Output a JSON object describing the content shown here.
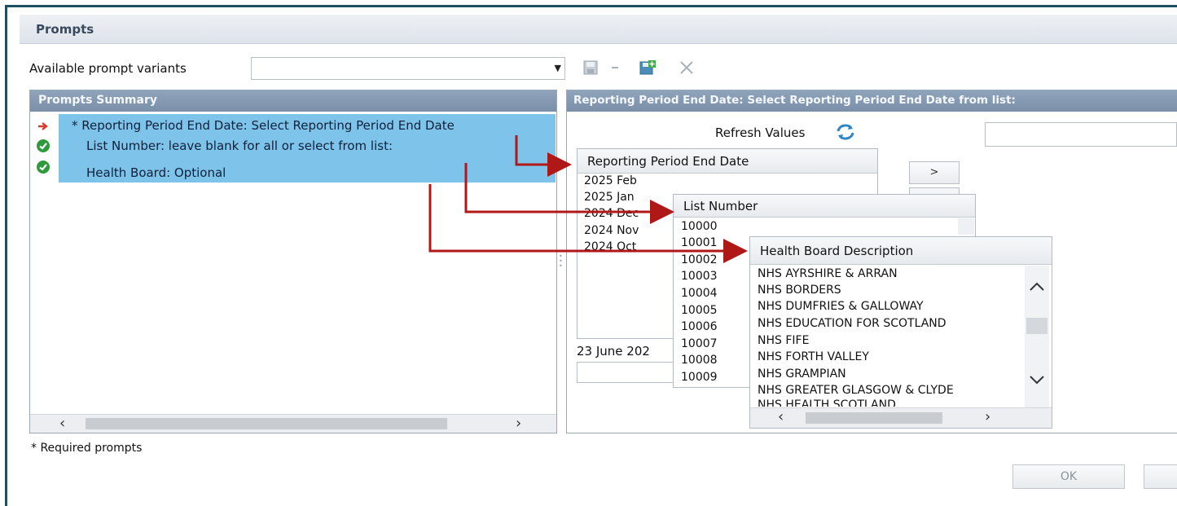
{
  "dialog": {
    "title": "Prompts"
  },
  "variants": {
    "label": "Available prompt variants",
    "value": ""
  },
  "toolbar": {
    "icons": [
      "save-icon",
      "save-as-icon",
      "delete-icon"
    ]
  },
  "summary": {
    "header": "Prompts Summary",
    "rows": [
      {
        "label": "* Reporting Period End Date: Select Reporting Period End Date",
        "status": "current-arrow-icon"
      },
      {
        "label": "List Number: leave blank for all or select from list:",
        "status": "check-icon"
      },
      {
        "label": "Health Board: Optional",
        "status": "check-icon"
      }
    ],
    "required_note": "* Required prompts"
  },
  "detail": {
    "header": "Reporting Period End Date: Select Reporting Period End Date from list:",
    "refresh_label": "Refresh Values",
    "move_label": ">",
    "selected_text": "23 June 202"
  },
  "lists": {
    "period": {
      "header": "Reporting Period End Date",
      "items": [
        "2025 Feb",
        "2025 Jan",
        "2024 Dec",
        "2024 Nov",
        "2024 Oct"
      ]
    },
    "list_number": {
      "header": "List Number",
      "items": [
        "10000",
        "10001",
        "10002",
        "10003",
        "10004",
        "10005",
        "10006",
        "10007",
        "10008",
        "10009"
      ]
    },
    "health_board": {
      "header": "Health Board Description",
      "items": [
        "NHS AYRSHIRE & ARRAN",
        "NHS BORDERS",
        "NHS DUMFRIES & GALLOWAY",
        "NHS EDUCATION FOR SCOTLAND",
        "NHS FIFE",
        "NHS FORTH VALLEY",
        "NHS GRAMPIAN",
        "NHS GREATER GLASGOW & CLYDE",
        "NHS HEALTH SCOTLAND"
      ]
    }
  },
  "footer": {
    "ok_label": "OK"
  },
  "colors": {
    "highlight": "#7ec4ea",
    "annotation_arrow": "#b01818",
    "panel_header": "#7f94ab"
  }
}
